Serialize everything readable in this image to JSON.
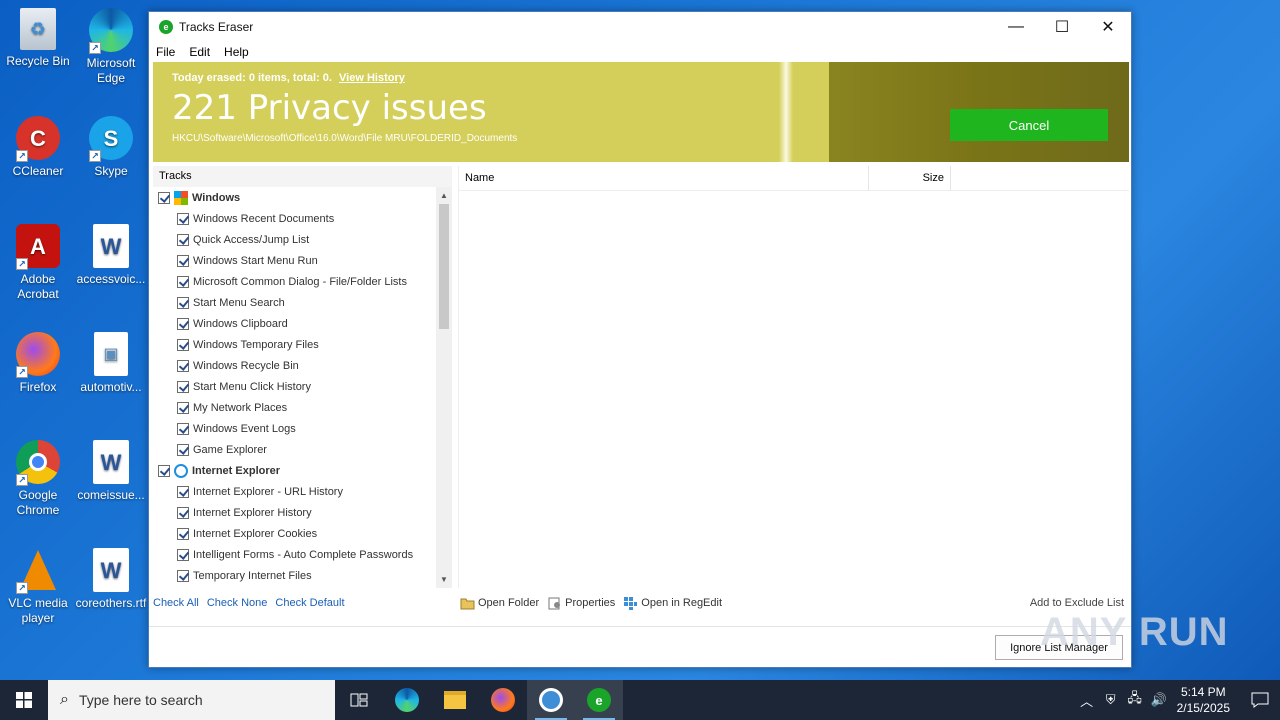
{
  "desktop": {
    "icons": [
      {
        "label": "Recycle Bin"
      },
      {
        "label": "Microsoft Edge"
      },
      {
        "label": "CCleaner"
      },
      {
        "label": "Skype"
      },
      {
        "label": "Adobe Acrobat"
      },
      {
        "label": "accessvoic..."
      },
      {
        "label": "Firefox"
      },
      {
        "label": "automotiv..."
      },
      {
        "label": "Google Chrome"
      },
      {
        "label": "comeissue..."
      },
      {
        "label": "VLC media player"
      },
      {
        "label": "coreothers.rtf"
      }
    ]
  },
  "window": {
    "title": "Tracks Eraser",
    "controls": {
      "minimize": "—",
      "maximize": "☐",
      "close": "✕"
    },
    "menu": [
      "File",
      "Edit",
      "Help"
    ]
  },
  "banner": {
    "today_text": "Today erased: 0 items, total: 0.",
    "view_history": "View History",
    "issues": "221 Privacy issues",
    "path": "HKCU\\Software\\Microsoft\\Office\\16.0\\Word\\File MRU\\FOLDERID_Documents",
    "cancel_label": "Cancel",
    "colors": {
      "light": "#d4cf5a",
      "dark": "#7a7418",
      "cancel": "#1fb51f"
    }
  },
  "tracks": {
    "header": "Tracks",
    "groups": [
      {
        "label": "Windows",
        "checked": true,
        "items": [
          "Windows Recent Documents",
          "Quick Access/Jump List",
          "Windows Start Menu Run",
          "Microsoft Common Dialog - File/Folder Lists",
          "Start Menu Search",
          "Windows Clipboard",
          "Windows Temporary Files",
          "Windows Recycle Bin",
          "Start Menu Click History",
          "My Network Places",
          "Windows Event Logs",
          "Game Explorer"
        ]
      },
      {
        "label": "Internet Explorer",
        "checked": true,
        "items": [
          "Internet Explorer - URL History",
          "Internet Explorer History",
          "Internet Explorer Cookies",
          "Intelligent Forms - Auto Complete Passwords",
          "Temporary Internet Files"
        ]
      }
    ]
  },
  "list": {
    "col_name": "Name",
    "col_size": "Size"
  },
  "links": {
    "check_all": "Check All",
    "check_none": "Check None",
    "check_default": "Check Default"
  },
  "actions": {
    "open_folder": "Open Folder",
    "properties": "Properties",
    "open_regedit": "Open in RegEdit",
    "add_exclude": "Add to Exclude List",
    "ignore_manager": "Ignore List Manager"
  },
  "watermark": "ANY RUN",
  "taskbar": {
    "search_placeholder": "Type here to search",
    "time": "5:14 PM",
    "date": "2/15/2025"
  }
}
